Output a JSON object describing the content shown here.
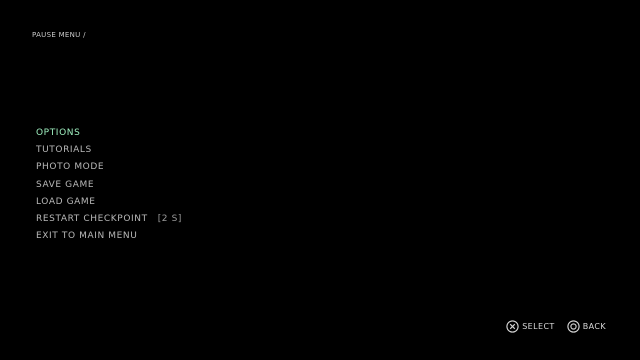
{
  "breadcrumb": "PAUSE MENU /",
  "menu": {
    "items": [
      {
        "label": "OPTIONS",
        "selected": true
      },
      {
        "label": "TUTORIALS"
      },
      {
        "label": "PHOTO MODE"
      },
      {
        "label": "SAVE GAME"
      },
      {
        "label": "LOAD GAME"
      },
      {
        "label": "RESTART CHECKPOINT",
        "hint": "[2 S]"
      },
      {
        "label": "EXIT TO MAIN MENU"
      }
    ]
  },
  "footer": {
    "select": {
      "label": "SELECT",
      "icon": "cross-button-icon"
    },
    "back": {
      "label": "BACK",
      "icon": "circle-button-icon"
    }
  },
  "colors": {
    "background": "#000000",
    "selected": "#9ff0c0",
    "text": "#b8b8b8"
  }
}
